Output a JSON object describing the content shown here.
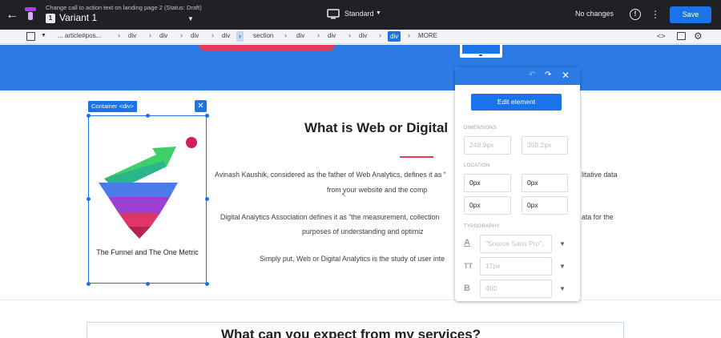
{
  "topbar": {
    "subtitle": "Change call to action text on landing page 2 (Status: Draft)",
    "variant_number": "1",
    "variant_name": "Variant 1",
    "device_mode": "Standard",
    "status": "No changes",
    "save_label": "Save",
    "colors": {
      "bar": "#202124",
      "save": "#1a73e8"
    }
  },
  "breadcrumb": {
    "items": [
      {
        "label": "... article#pos...",
        "state": "normal"
      },
      {
        "label": "div",
        "state": "normal"
      },
      {
        "label": "div",
        "state": "normal"
      },
      {
        "label": "div",
        "state": "normal"
      },
      {
        "label": "div",
        "state": "normal"
      },
      {
        "label": "section",
        "state": "highlight"
      },
      {
        "label": "div",
        "state": "normal"
      },
      {
        "label": "div",
        "state": "normal"
      },
      {
        "label": "div",
        "state": "normal"
      },
      {
        "label": "div",
        "state": "active"
      },
      {
        "label": "MORE",
        "state": "normal"
      }
    ],
    "code_icon": "<>"
  },
  "canvas": {
    "container_tag": "Container <div>",
    "image_caption": "The Funnel and The One Metric",
    "heading": "What is Web or Digital",
    "paragraphs": [
      "Avinash Kaushik, considered as the father of Web Analytics, defines it as “",
      "from your website and the comp",
      "Digital Analytics Association defines it as “the measurement, collection",
      "purposes of understanding and optimiz",
      "Simply put, Web or Digital Analytics is the study of user inte"
    ],
    "paragraphs_right": [
      "litative data",
      "ata for the"
    ],
    "section2_heading": "What can you expect from my services?",
    "colors": {
      "hero": "#2c7be5",
      "accent": "#e53e5b",
      "selection": "#1a73e8"
    }
  },
  "panel": {
    "edit_button": "Edit element",
    "dimensions_label": "DIMENSIONS",
    "width_value": "248.9px",
    "height_value": "358.2px",
    "location_label": "LOCATION",
    "location_values": [
      "0px",
      "0px",
      "0px",
      "0px"
    ],
    "typography_label": "TYPOGRAPHY",
    "font_family": "\"Source Sans Pro\",",
    "font_size": "17px",
    "font_weight": "400",
    "icons": [
      "undo-icon",
      "redo-icon",
      "close-icon",
      "font-family-icon",
      "font-size-icon",
      "font-weight-icon"
    ]
  }
}
